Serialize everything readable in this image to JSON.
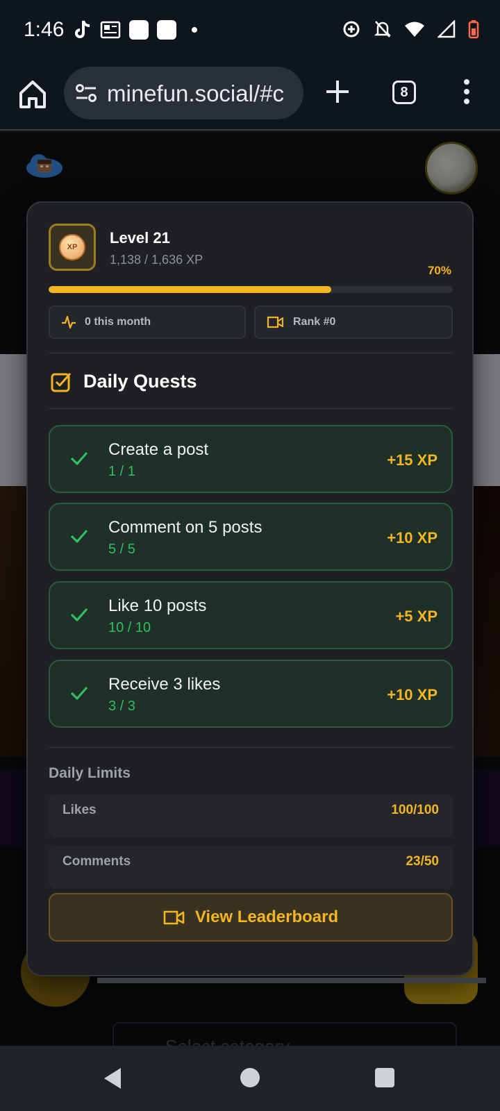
{
  "status_bar": {
    "time": "1:46"
  },
  "browser": {
    "url": "minefun.social/#c",
    "tab_count": "8"
  },
  "background": {
    "select_placeholder": "Select category"
  },
  "panel": {
    "level_title": "Level 21",
    "level_xp": "1,138 / 1,636 XP",
    "level_percent_label": "70%",
    "level_progress": 0.7,
    "stat_month": "0 this month",
    "stat_rank": "Rank #0",
    "daily_quests_title": "Daily Quests",
    "quests": [
      {
        "name": "Create a post",
        "progress": "1 / 1",
        "xp": "+15 XP"
      },
      {
        "name": "Comment on 5 posts",
        "progress": "5 / 5",
        "xp": "+10 XP"
      },
      {
        "name": "Like 10 posts",
        "progress": "10 / 10",
        "xp": "+5 XP"
      },
      {
        "name": "Receive 3 likes",
        "progress": "3 / 3",
        "xp": "+10 XP"
      }
    ],
    "daily_limits_title": "Daily Limits",
    "limits": [
      {
        "label": "Likes",
        "value": "100/100"
      },
      {
        "label": "Comments",
        "value": "23/50"
      }
    ],
    "leaderboard_button": "View Leaderboard"
  },
  "colors": {
    "accent": "#f3b523",
    "success": "#2fbf62",
    "panel_bg": "#1e2024"
  }
}
